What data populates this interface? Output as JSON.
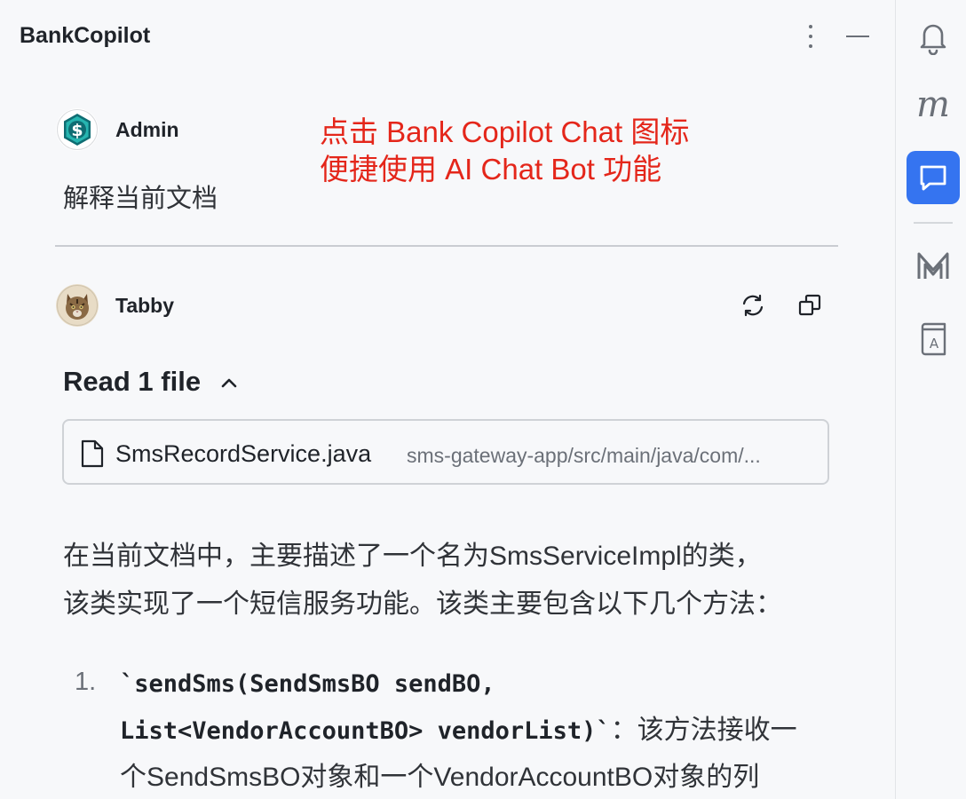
{
  "header": {
    "title": "BankCopilot",
    "more_icon": "vertical-ellipsis-icon",
    "minimize_icon": "minimize-icon"
  },
  "right_rail": {
    "items": [
      {
        "name": "notifications",
        "icon": "bell-icon"
      },
      {
        "name": "m-tool",
        "icon": "m-italic-icon",
        "text": "m"
      },
      {
        "name": "chat",
        "icon": "chat-bubble-icon",
        "active": true
      },
      {
        "name": "m-logo",
        "icon": "m-logo-icon"
      },
      {
        "name": "dictionary",
        "icon": "book-a-icon",
        "text": "A"
      }
    ],
    "accent": "#3574f0"
  },
  "messages": [
    {
      "author": "Admin",
      "avatar": "dollar-coin-avatar",
      "text": "解释当前文档"
    },
    {
      "author": "Tabby",
      "avatar": "tabby-cat-avatar"
    }
  ],
  "annotation": {
    "lines": [
      "点击 Bank Copilot Chat 图标",
      "便捷使用 AI Chat Bot 功能"
    ],
    "color": "#e4261a"
  },
  "response": {
    "actions": [
      {
        "name": "regenerate",
        "icon": "refresh-icon"
      },
      {
        "name": "copy",
        "icon": "copy-icon"
      }
    ],
    "read_files_label": "Read 1 file",
    "file": {
      "name": "SmsRecordService.java",
      "path": "sms-gateway-app/src/main/java/com/..."
    },
    "paragraph_lines": [
      "在当前文档中，主要描述了一个名为SmsServiceImpl的类，",
      "该类实现了一个短信服务功能。该类主要包含以下几个方法："
    ],
    "list": [
      {
        "number": "1.",
        "code_line1": "`sendSms(SendSmsBO sendBO,",
        "code_line2": "List<VendorAccountBO> vendorList)`",
        "after_code": "：该方法接收一",
        "line3": "个SendSmsBO对象和一个VendorAccountBO对象的列"
      }
    ]
  }
}
